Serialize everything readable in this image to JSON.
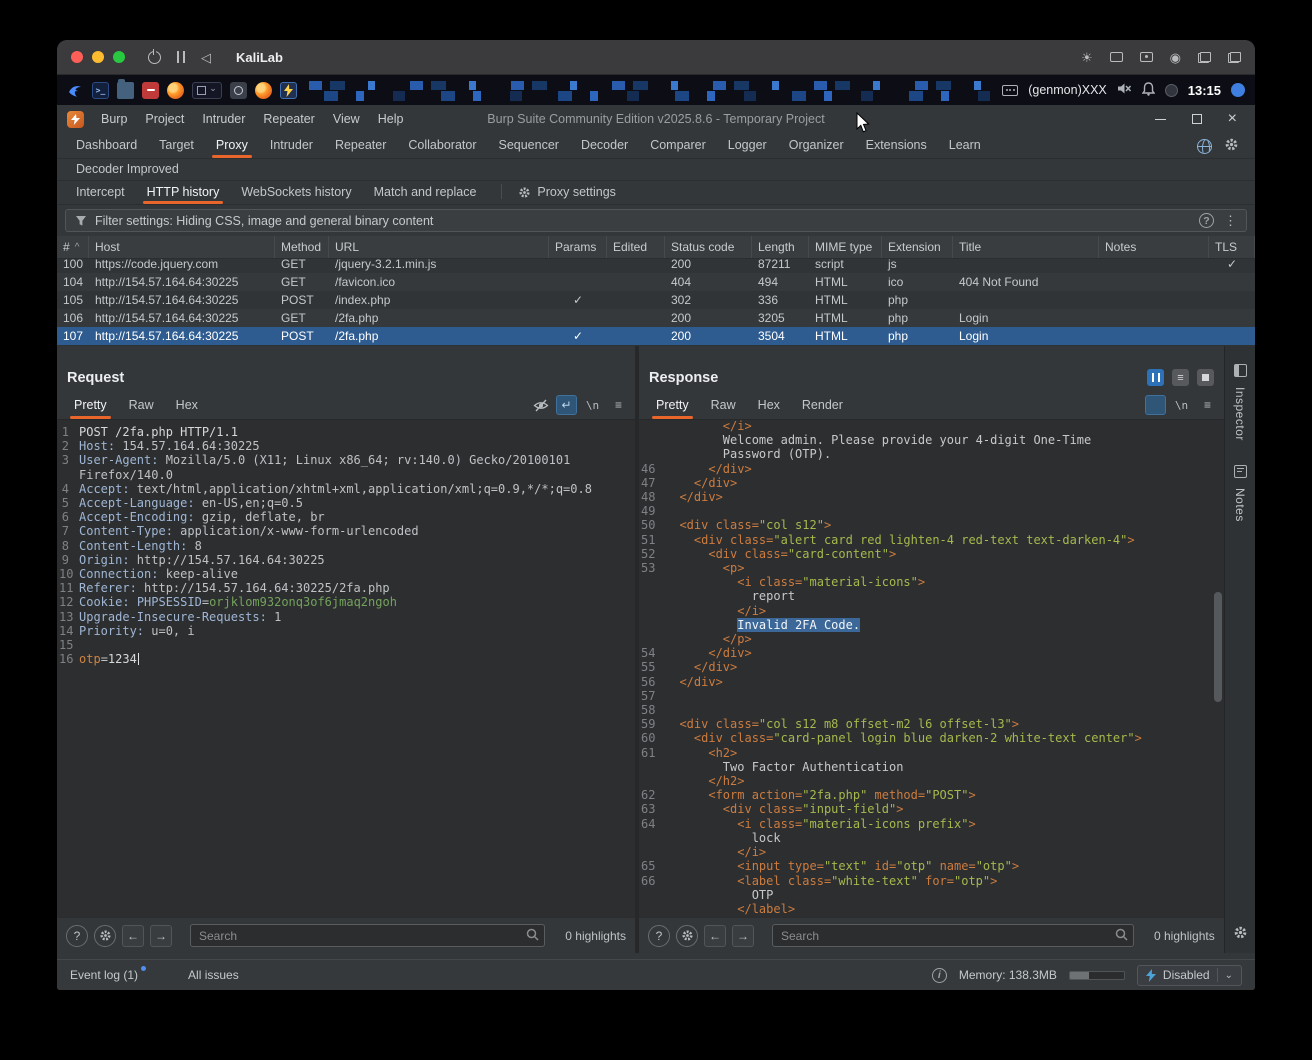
{
  "vm": {
    "title": "KaliLab",
    "window_controls": [
      "close",
      "minimize",
      "zoom"
    ],
    "toolbar_icons_left": [
      "power-icon",
      "pause-icon",
      "back-icon"
    ],
    "toolbar_icons_right": [
      "brightness-icon",
      "camera-icon",
      "drive-icon",
      "record-icon",
      "windows-icon",
      "copy-icon"
    ],
    "brightness_glyph": "☀",
    "record_glyph": "◉",
    "back_glyph": "◁"
  },
  "kali": {
    "taskbar_icons": [
      "kali-menu-icon",
      "terminal-icon",
      "file-manager-icon",
      "text-editor-icon",
      "firefox-icon",
      "workspace-switcher",
      "screenshot-icon",
      "firefox-app-icon",
      "burp-app-icon"
    ],
    "status_text": "(genmon)XXX",
    "tray_icons": [
      "keyboard-icon",
      "volume-muted-icon",
      "notifications-icon",
      "status-orb-icon",
      "menu-orb-icon"
    ],
    "clock": "13:15"
  },
  "burp": {
    "menu": [
      "Burp",
      "Project",
      "Intruder",
      "Repeater",
      "View",
      "Help"
    ],
    "window_title": "Burp Suite Community Edition v2025.8.6 - Temporary Project",
    "main_tabs": [
      "Dashboard",
      "Target",
      "Proxy",
      "Intruder",
      "Repeater",
      "Collaborator",
      "Sequencer",
      "Decoder",
      "Comparer",
      "Logger",
      "Organizer",
      "Extensions",
      "Learn"
    ],
    "active_main_tab": "Proxy",
    "extension_tabs": [
      "Decoder Improved"
    ],
    "proxy_tabs": [
      "Intercept",
      "HTTP history",
      "WebSockets history",
      "Match and replace"
    ],
    "active_proxy_tab": "HTTP history",
    "proxy_settings_label": "Proxy settings",
    "filter_text": "Filter settings: Hiding CSS, image and general binary content",
    "history": {
      "columns": [
        "#",
        "Host",
        "Method",
        "URL",
        "Params",
        "Edited",
        "Status code",
        "Length",
        "MIME type",
        "Extension",
        "Title",
        "Notes",
        "TLS"
      ],
      "sorted_column": "#",
      "rows": [
        {
          "num": "100",
          "host": "https://code.jquery.com",
          "method": "GET",
          "url": "/jquery-3.2.1.min.js",
          "params": false,
          "edited": false,
          "status": "200",
          "length": "87211",
          "mime": "script",
          "ext": "js",
          "title": "",
          "notes": "",
          "tls": true,
          "selected": false
        },
        {
          "num": "104",
          "host": "http://154.57.164.64:30225",
          "method": "GET",
          "url": "/favicon.ico",
          "params": false,
          "edited": false,
          "status": "404",
          "length": "494",
          "mime": "HTML",
          "ext": "ico",
          "title": "404 Not Found",
          "notes": "",
          "tls": false,
          "selected": false
        },
        {
          "num": "105",
          "host": "http://154.57.164.64:30225",
          "method": "POST",
          "url": "/index.php",
          "params": true,
          "edited": false,
          "status": "302",
          "length": "336",
          "mime": "HTML",
          "ext": "php",
          "title": "",
          "notes": "",
          "tls": false,
          "selected": false
        },
        {
          "num": "106",
          "host": "http://154.57.164.64:30225",
          "method": "GET",
          "url": "/2fa.php",
          "params": false,
          "edited": false,
          "status": "200",
          "length": "3205",
          "mime": "HTML",
          "ext": "php",
          "title": "Login",
          "notes": "",
          "tls": false,
          "selected": false
        },
        {
          "num": "107",
          "host": "http://154.57.164.64:30225",
          "method": "POST",
          "url": "/2fa.php",
          "params": true,
          "edited": false,
          "status": "200",
          "length": "3504",
          "mime": "HTML",
          "ext": "php",
          "title": "Login",
          "notes": "",
          "tls": false,
          "selected": true
        }
      ]
    },
    "request": {
      "title": "Request",
      "tabs": [
        "Pretty",
        "Raw",
        "Hex"
      ],
      "active_tab": "Pretty",
      "toolbar_icons": [
        "hide-icon",
        "wrap-icon",
        "newline-icon",
        "menu-icon"
      ],
      "newline_glyph": "\\n",
      "wrap_glyph": "↵",
      "search_placeholder": "Search",
      "highlights_label": "0 highlights",
      "lines": [
        {
          "n": "1",
          "p": [
            [
              "p",
              "POST /2fa.php HTTP/1.1"
            ]
          ]
        },
        {
          "n": "2",
          "p": [
            [
              "h",
              "Host:"
            ],
            [
              "v",
              " 154.57.164.64:30225"
            ]
          ]
        },
        {
          "n": "3",
          "p": [
            [
              "h",
              "User-Agent:"
            ],
            [
              "v",
              " Mozilla/5.0 (X11; Linux x86_64; rv:140.0) Gecko/20100101 Firefox/140.0"
            ]
          ]
        },
        {
          "n": "4",
          "p": [
            [
              "h",
              "Accept:"
            ],
            [
              "v",
              " text/html,application/xhtml+xml,application/xml;q=0.9,*/*;q=0.8"
            ]
          ]
        },
        {
          "n": "5",
          "p": [
            [
              "h",
              "Accept-Language:"
            ],
            [
              "v",
              " en-US,en;q=0.5"
            ]
          ]
        },
        {
          "n": "6",
          "p": [
            [
              "h",
              "Accept-Encoding:"
            ],
            [
              "v",
              " gzip, deflate, br"
            ]
          ]
        },
        {
          "n": "7",
          "p": [
            [
              "h",
              "Content-Type:"
            ],
            [
              "v",
              " application/x-www-form-urlencoded"
            ]
          ]
        },
        {
          "n": "8",
          "p": [
            [
              "h",
              "Content-Length:"
            ],
            [
              "v",
              " 8"
            ]
          ]
        },
        {
          "n": "9",
          "p": [
            [
              "h",
              "Origin:"
            ],
            [
              "v",
              " http://154.57.164.64:30225"
            ]
          ]
        },
        {
          "n": "10",
          "p": [
            [
              "h",
              "Connection:"
            ],
            [
              "v",
              " keep-alive"
            ]
          ]
        },
        {
          "n": "11",
          "p": [
            [
              "h",
              "Referer:"
            ],
            [
              "v",
              " http://154.57.164.64:30225/2fa.php"
            ]
          ]
        },
        {
          "n": "12",
          "p": [
            [
              "h",
              "Cookie:"
            ],
            [
              "v",
              " "
            ],
            [
              "h",
              "PHPSESSID"
            ],
            [
              "v",
              "="
            ],
            [
              "g",
              "orjklom932onq3of6jmaq2ngoh"
            ]
          ]
        },
        {
          "n": "13",
          "p": [
            [
              "h",
              "Upgrade-Insecure-Requests:"
            ],
            [
              "v",
              " 1"
            ]
          ]
        },
        {
          "n": "14",
          "p": [
            [
              "h",
              "Priority:"
            ],
            [
              "v",
              " u=0, i"
            ]
          ]
        },
        {
          "n": "15",
          "p": []
        },
        {
          "n": "16",
          "p": [
            [
              "o",
              "otp"
            ],
            [
              "v",
              "="
            ],
            [
              "p",
              "1234"
            ],
            [
              "caret",
              ""
            ]
          ]
        }
      ]
    },
    "response": {
      "title": "Response",
      "tabs": [
        "Pretty",
        "Raw",
        "Hex",
        "Render"
      ],
      "active_tab": "Pretty",
      "corner_buttons": [
        "pause-button",
        "rows-button",
        "stop-button"
      ],
      "toolbar_icons": [
        "wrap-icon",
        "newline-icon",
        "menu-icon"
      ],
      "search_placeholder": "Search",
      "highlights_label": "0 highlights",
      "lines": [
        {
          "n": "",
          "p": [
            [
              "tag",
              "        </i>"
            ]
          ]
        },
        {
          "n": "",
          "p": [
            [
              "txt",
              "        Welcome admin. Please provide your 4-digit One-Time"
            ]
          ]
        },
        {
          "n": "",
          "p": [
            [
              "txt",
              "        Password (OTP)."
            ]
          ]
        },
        {
          "n": "46",
          "p": [
            [
              "tag",
              "      </div>"
            ]
          ]
        },
        {
          "n": "47",
          "p": [
            [
              "tag",
              "    </div>"
            ]
          ]
        },
        {
          "n": "48",
          "p": [
            [
              "tag",
              "  </div>"
            ]
          ]
        },
        {
          "n": "49",
          "p": []
        },
        {
          "n": "50",
          "p": [
            [
              "tag",
              "  <div class="
            ],
            [
              "str",
              "\"col s12\""
            ],
            [
              "tag",
              ">"
            ]
          ]
        },
        {
          "n": "51",
          "p": [
            [
              "tag",
              "    <div class="
            ],
            [
              "str",
              "\"alert card red lighten-4 red-text text-darken-4\""
            ],
            [
              "tag",
              ">"
            ]
          ]
        },
        {
          "n": "52",
          "p": [
            [
              "tag",
              "      <div class="
            ],
            [
              "str",
              "\"card-content\""
            ],
            [
              "tag",
              ">"
            ]
          ]
        },
        {
          "n": "53",
          "p": [
            [
              "tag",
              "        <p>"
            ]
          ]
        },
        {
          "n": "",
          "p": [
            [
              "tag",
              "          <i class="
            ],
            [
              "str",
              "\"material-icons\""
            ],
            [
              "tag",
              ">"
            ]
          ]
        },
        {
          "n": "",
          "p": [
            [
              "txt",
              "            report"
            ]
          ]
        },
        {
          "n": "",
          "p": [
            [
              "tag",
              "          </i>"
            ]
          ]
        },
        {
          "n": "",
          "p": [
            [
              "txt",
              "          "
            ],
            [
              "hl",
              "Invalid 2FA Code."
            ]
          ]
        },
        {
          "n": "",
          "p": [
            [
              "tag",
              "        </p>"
            ]
          ]
        },
        {
          "n": "54",
          "p": [
            [
              "tag",
              "      </div>"
            ]
          ]
        },
        {
          "n": "55",
          "p": [
            [
              "tag",
              "    </div>"
            ]
          ]
        },
        {
          "n": "56",
          "p": [
            [
              "tag",
              "  </div>"
            ]
          ]
        },
        {
          "n": "57",
          "p": []
        },
        {
          "n": "58",
          "p": []
        },
        {
          "n": "59",
          "p": [
            [
              "tag",
              "  <div class="
            ],
            [
              "str",
              "\"col s12 m8 offset-m2 l6 offset-l3\""
            ],
            [
              "tag",
              ">"
            ]
          ]
        },
        {
          "n": "60",
          "p": [
            [
              "tag",
              "    <div class="
            ],
            [
              "str",
              "\"card-panel login blue darken-2 white-text center\""
            ],
            [
              "tag",
              ">"
            ]
          ]
        },
        {
          "n": "61",
          "p": [
            [
              "tag",
              "      <h2>"
            ]
          ]
        },
        {
          "n": "",
          "p": [
            [
              "txt",
              "        Two Factor Authentication"
            ]
          ]
        },
        {
          "n": "",
          "p": [
            [
              "tag",
              "      </h2>"
            ]
          ]
        },
        {
          "n": "62",
          "p": [
            [
              "tag",
              "      <form action="
            ],
            [
              "str",
              "\"2fa.php\""
            ],
            [
              "tag",
              " method="
            ],
            [
              "str",
              "\"POST\""
            ],
            [
              "tag",
              ">"
            ]
          ]
        },
        {
          "n": "63",
          "p": [
            [
              "tag",
              "        <div class="
            ],
            [
              "str",
              "\"input-field\""
            ],
            [
              "tag",
              ">"
            ]
          ]
        },
        {
          "n": "64",
          "p": [
            [
              "tag",
              "          <i class="
            ],
            [
              "str",
              "\"material-icons prefix\""
            ],
            [
              "tag",
              ">"
            ]
          ]
        },
        {
          "n": "",
          "p": [
            [
              "txt",
              "            lock"
            ]
          ]
        },
        {
          "n": "",
          "p": [
            [
              "tag",
              "          </i>"
            ]
          ]
        },
        {
          "n": "65",
          "p": [
            [
              "tag",
              "          <input type="
            ],
            [
              "str",
              "\"text\""
            ],
            [
              "tag",
              " id="
            ],
            [
              "str",
              "\"otp\""
            ],
            [
              "tag",
              " name="
            ],
            [
              "str",
              "\"otp\""
            ],
            [
              "tag",
              ">"
            ]
          ]
        },
        {
          "n": "66",
          "p": [
            [
              "tag",
              "          <label class="
            ],
            [
              "str",
              "\"white-text\""
            ],
            [
              "tag",
              " for="
            ],
            [
              "str",
              "\"otp\""
            ],
            [
              "tag",
              ">"
            ]
          ]
        },
        {
          "n": "",
          "p": [
            [
              "txt",
              "            OTP"
            ]
          ]
        },
        {
          "n": "",
          "p": [
            [
              "tag",
              "          </label>"
            ]
          ]
        }
      ]
    },
    "side_panels": {
      "inspector": "Inspector",
      "notes": "Notes"
    },
    "statusbar": {
      "event_log": "Event log (1)",
      "all_issues": "All issues",
      "memory": "Memory: 138.3MB",
      "intercept_state": "Disabled"
    }
  }
}
